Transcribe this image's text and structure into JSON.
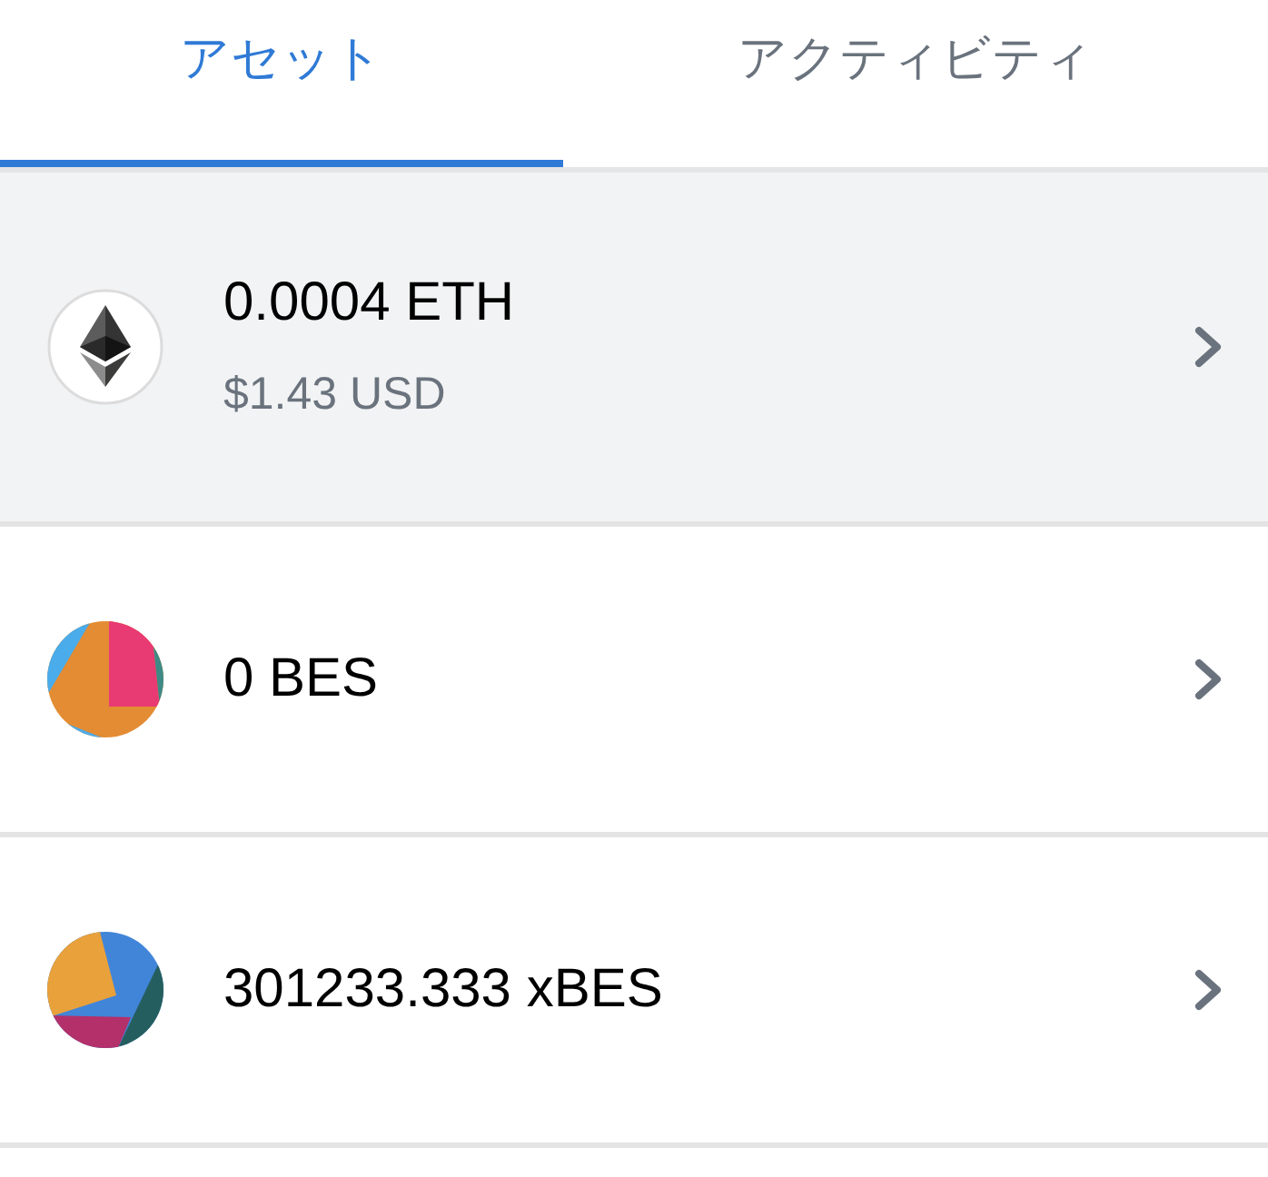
{
  "tabs": [
    {
      "label": "アセット",
      "selected": true
    },
    {
      "label": "アクティビティ",
      "selected": false
    }
  ],
  "assets": [
    {
      "kind": "ether",
      "amount": "0.0004 ETH",
      "fiat": "$1.43 USD",
      "selected": true
    },
    {
      "kind": "identicon",
      "amount": "0 BES",
      "selected": false
    },
    {
      "kind": "identicon",
      "amount": "301233.333 xBES",
      "selected": false
    }
  ]
}
